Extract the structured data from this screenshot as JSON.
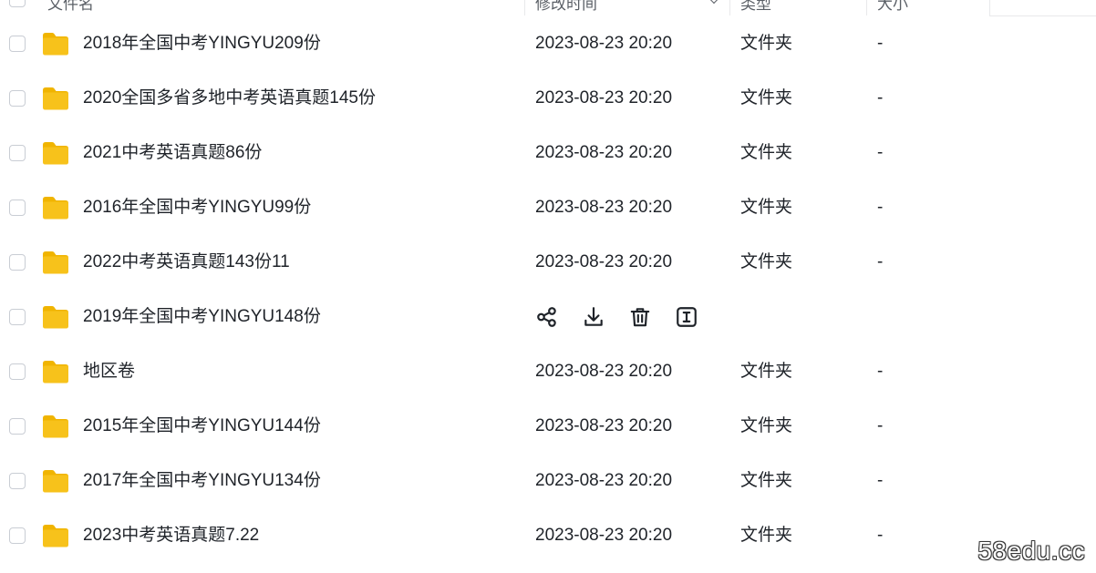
{
  "header": {
    "columns": [
      "文件名",
      "修改时间",
      "类型",
      "大小"
    ]
  },
  "rows": [
    {
      "name": "2018年全国中考YINGYU209份",
      "date": "2023-08-23 20:20",
      "type": "文件夹",
      "size": "-"
    },
    {
      "name": "2020全国多省多地中考英语真题145份",
      "date": "2023-08-23 20:20",
      "type": "文件夹",
      "size": "-"
    },
    {
      "name": "2021中考英语真题86份",
      "date": "2023-08-23 20:20",
      "type": "文件夹",
      "size": "-"
    },
    {
      "name": "2016年全国中考YINGYU99份",
      "date": "2023-08-23 20:20",
      "type": "文件夹",
      "size": "-"
    },
    {
      "name": "2022中考英语真题143份11",
      "date": "2023-08-23 20:20",
      "type": "文件夹",
      "size": "-"
    },
    {
      "name": "2019年全国中考YINGYU148份",
      "hovered": true,
      "actions": [
        "share-icon",
        "download-icon",
        "delete-icon",
        "rename-icon"
      ]
    },
    {
      "name": "地区卷",
      "date": "2023-08-23 20:20",
      "type": "文件夹",
      "size": "-"
    },
    {
      "name": "2015年全国中考YINGYU144份",
      "date": "2023-08-23 20:20",
      "type": "文件夹",
      "size": "-"
    },
    {
      "name": "2017年全国中考YINGYU134份",
      "date": "2023-08-23 20:20",
      "type": "文件夹",
      "size": "-"
    },
    {
      "name": "2023中考英语真题7.22",
      "date": "2023-08-23 20:20",
      "type": "文件夹",
      "size": "-"
    }
  ],
  "watermark": "58edu.cc",
  "colors": {
    "folder": "#f7c21b",
    "folder_tab": "#f0b400",
    "text": "#1f2329"
  }
}
